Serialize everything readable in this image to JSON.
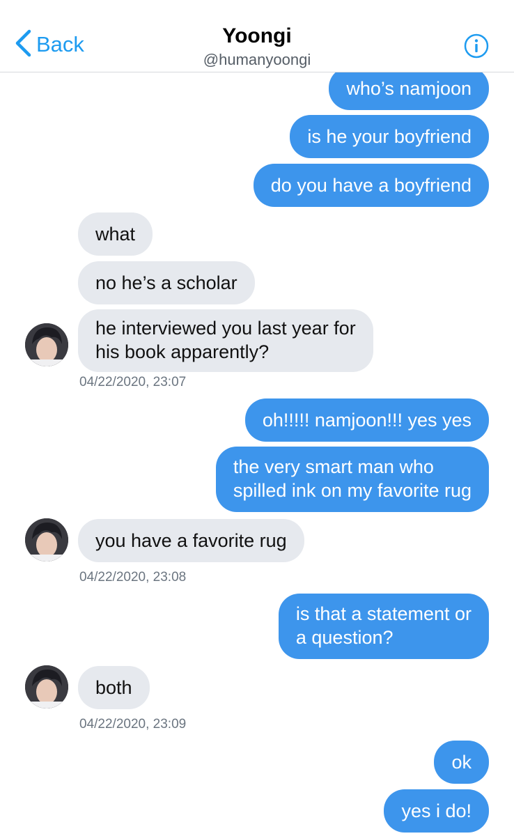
{
  "header": {
    "back_label": "Back",
    "title": "Yoongi",
    "handle": "@humanyoongi"
  },
  "messages": [
    {
      "text": "who’s namjoon"
    },
    {
      "text": "is he your boyfriend"
    },
    {
      "text": "do you have a boyfriend"
    },
    {
      "text": "what"
    },
    {
      "text": "no he’s a scholar"
    },
    {
      "text": "he interviewed you last year for\nhis book apparently?"
    },
    {
      "text": "oh!!!!! namjoon!!! yes yes"
    },
    {
      "text": "the very smart man who\nspilled ink on my favorite rug"
    },
    {
      "text": "you have a favorite rug"
    },
    {
      "text": "is that a statement or\na question?"
    },
    {
      "text": "both"
    },
    {
      "text": "ok"
    },
    {
      "text": "yes i do!"
    }
  ],
  "timestamps": [
    "04/22/2020, 23:07",
    "04/22/2020, 23:08",
    "04/22/2020, 23:09"
  ],
  "colors": {
    "accent": "#1d9bf0",
    "outgoing_bubble": "#3d95ec",
    "incoming_bubble": "#e6e9ee"
  }
}
